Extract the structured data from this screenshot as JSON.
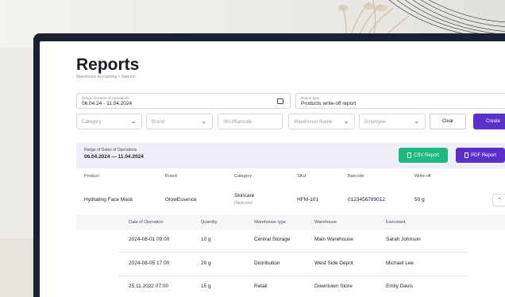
{
  "page": {
    "title": "Reports",
    "breadcrumb": {
      "root": "Warehouse Accounting",
      "separator": ">",
      "current": "Reports"
    }
  },
  "filters": {
    "date_range": {
      "label": "Range of Dates of Operations",
      "value": "06.04.24 - 11.04.2024",
      "icon": "calendar-icon"
    },
    "report_type": {
      "label": "Report type",
      "value": "Products write-off report",
      "icon": "chevron-down-icon"
    },
    "category": {
      "placeholder": "Category"
    },
    "brand": {
      "placeholder": "Brand"
    },
    "sku": {
      "placeholder": "SKU/Barcode"
    },
    "warehouse": {
      "placeholder": "Warehouse Name"
    },
    "employee": {
      "placeholder": "Employee"
    },
    "clear_label": "Clear",
    "create_label": "Create"
  },
  "report": {
    "range_label": "Range of Dates of Operations",
    "range_value": "06.04.2024 — 11.04.2024",
    "csv_label": "CSV Report",
    "pdf_label": "PDF Report",
    "colors": {
      "csv": "#1fb980",
      "pdf": "#5b2fc9",
      "band": "#f0eef8"
    }
  },
  "table": {
    "headers": [
      "Product",
      "Brand",
      "Category",
      "SKU",
      "Barcode",
      "Write-off"
    ],
    "row": {
      "product": "Hydrating Face Mask",
      "brand": "GlowEssence",
      "category": "Skincare",
      "category_sub": "(Skincare)",
      "sku": "HFM-101",
      "barcode": "0123456789012",
      "writeoff": "50 g"
    },
    "sub_headers": [
      "Date of Operation",
      "Quantity",
      "Warehouse type",
      "Warehouse",
      "Executant"
    ],
    "sub_rows": [
      {
        "date": "2024-08-01 09:00",
        "quantity": "10 g",
        "type": "Central Storage",
        "warehouse": "Main Warehouse",
        "executant": "Sarah Johnson"
      },
      {
        "date": "2024-08-05 17:00",
        "quantity": "20 g",
        "type": "Distribution",
        "warehouse": "West Side Depot",
        "executant": "Michael Lee"
      },
      {
        "date": "25.11.2022 07:00",
        "quantity": "15 g",
        "type": "Retail",
        "warehouse": "Downtown Store",
        "executant": "Emily Davis"
      }
    ]
  }
}
